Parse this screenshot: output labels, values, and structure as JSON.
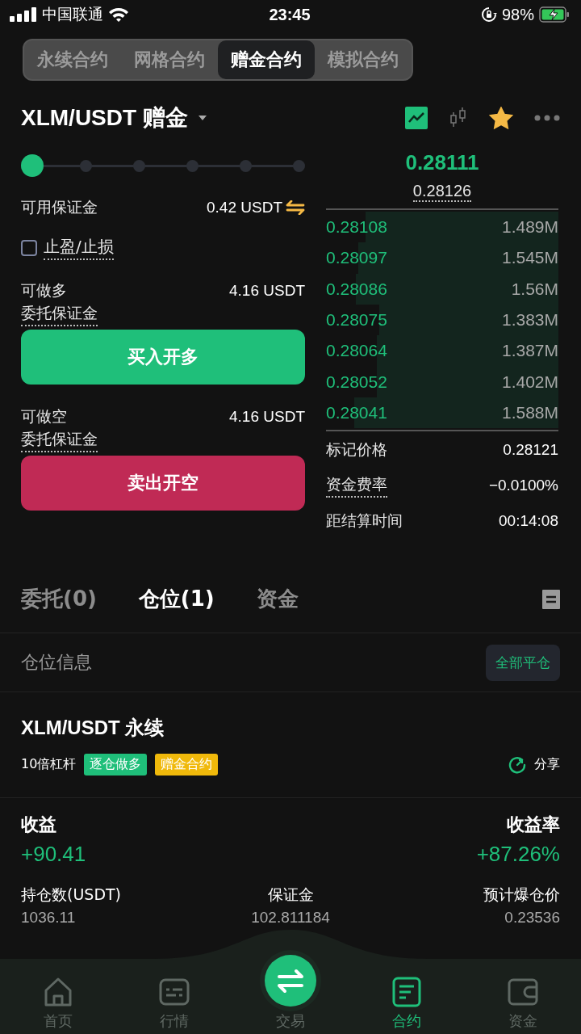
{
  "status_bar": {
    "carrier": "中国联通",
    "time": "23:45",
    "battery": "98%"
  },
  "mode_tabs": [
    {
      "label": "永续合约",
      "selected": false
    },
    {
      "label": "网格合约",
      "selected": false
    },
    {
      "label": "赠金合约",
      "selected": true
    },
    {
      "label": "模拟合约",
      "selected": false
    }
  ],
  "header": {
    "pair": "XLM/USDT 赠金",
    "chart_modes": [
      {
        "kind": "line",
        "selected": true
      },
      {
        "kind": "candle",
        "selected": false
      }
    ],
    "favorite": true
  },
  "leverage_slider": {
    "level": 0
  },
  "available_margin": {
    "label": "可用保证金",
    "value": "0.42 USDT"
  },
  "tp_sl": {
    "label": "止盈/止损",
    "checked": false
  },
  "long": {
    "label": "可做多",
    "value": "4.16 USDT",
    "sublabel": "委托保证金",
    "button": "买入开多"
  },
  "short": {
    "label": "可做空",
    "value": "4.16 USDT",
    "sublabel": "委托保证金",
    "button": "卖出开空"
  },
  "ticker": {
    "last_price": "0.28111",
    "index_price": "0.28126"
  },
  "order_book": [
    {
      "price": "0.28108",
      "amount": "1.489M",
      "level": 0.83
    },
    {
      "price": "0.28097",
      "amount": "1.545M",
      "level": 0.86
    },
    {
      "price": "0.28086",
      "amount": "1.56M",
      "level": 0.87
    },
    {
      "price": "0.28075",
      "amount": "1.383M",
      "level": 0.77
    },
    {
      "price": "0.28064",
      "amount": "1.387M",
      "level": 0.78
    },
    {
      "price": "0.28052",
      "amount": "1.402M",
      "level": 0.78
    },
    {
      "price": "0.28041",
      "amount": "1.588M",
      "level": 0.88
    }
  ],
  "market_info": [
    {
      "label": "标记价格",
      "value": "0.28121",
      "dotted": false
    },
    {
      "label": "资金费率",
      "value": "−0.0100%",
      "dotted": true
    },
    {
      "label": "距结算时间",
      "value": "00:14:08",
      "dotted": false
    }
  ],
  "order_tabs": [
    {
      "label": "委托(0)",
      "selected": false
    },
    {
      "label": "仓位(1)",
      "selected": true
    },
    {
      "label": "资金",
      "selected": false
    }
  ],
  "positions_header": {
    "title": "仓位信息",
    "close_all": "全部平仓"
  },
  "position": {
    "symbol": "XLM/USDT 永续",
    "leverage": "10倍杠杆",
    "tags": [
      {
        "label": "逐仓做多",
        "color": "#1fbf7a"
      },
      {
        "label": "赠金合约",
        "color": "#f0b90b"
      }
    ],
    "share": "分享",
    "pnl_label": "收益",
    "pnl": "+90.41",
    "roe_label": "收益率",
    "roe": "+87.26%",
    "stats": [
      {
        "label": "持仓数(USDT)",
        "value": "1036.11"
      },
      {
        "label": "保证金",
        "value": "102.811184"
      },
      {
        "label": "预计爆仓价",
        "value": "0.23536"
      }
    ]
  },
  "bottom_nav": [
    {
      "label": "首页",
      "kind": "home",
      "selected": false
    },
    {
      "label": "行情",
      "kind": "market",
      "selected": false
    },
    {
      "label": "交易",
      "kind": "trade",
      "selected": false
    },
    {
      "label": "合约",
      "kind": "contract",
      "selected": true
    },
    {
      "label": "资金",
      "kind": "wallet",
      "selected": false
    }
  ]
}
